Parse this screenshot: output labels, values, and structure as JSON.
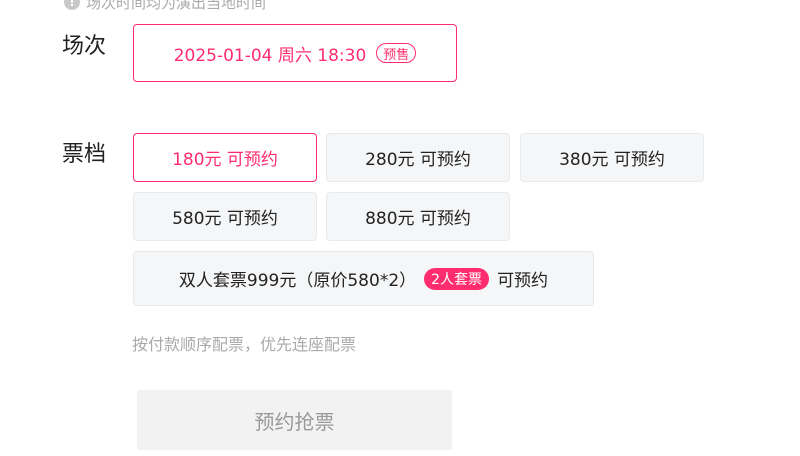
{
  "notice": {
    "text": "场次时间均为演出当地时间",
    "icon": "info-icon"
  },
  "session": {
    "label": "场次",
    "selected_value": "2025-01-04 周六 18:30",
    "badge": "预售"
  },
  "tiers": {
    "label": "票档",
    "items": [
      {
        "label": "180元 可预约",
        "selected": true
      },
      {
        "label": "280元 可预约",
        "selected": false
      },
      {
        "label": "380元 可预约",
        "selected": false
      },
      {
        "label": "580元 可预约",
        "selected": false
      },
      {
        "label": "880元 可预约",
        "selected": false
      }
    ],
    "package": {
      "label": "双人套票999元（原价580*2）",
      "badge": "2人套票",
      "status": "可预约"
    }
  },
  "tip": "按付款顺序配票，优先连座配票",
  "submit_label": "预约抢票",
  "colors": {
    "accent": "#ff2d6f",
    "muted": "#aaaaaa",
    "tile_bg": "#f5f6f7"
  }
}
